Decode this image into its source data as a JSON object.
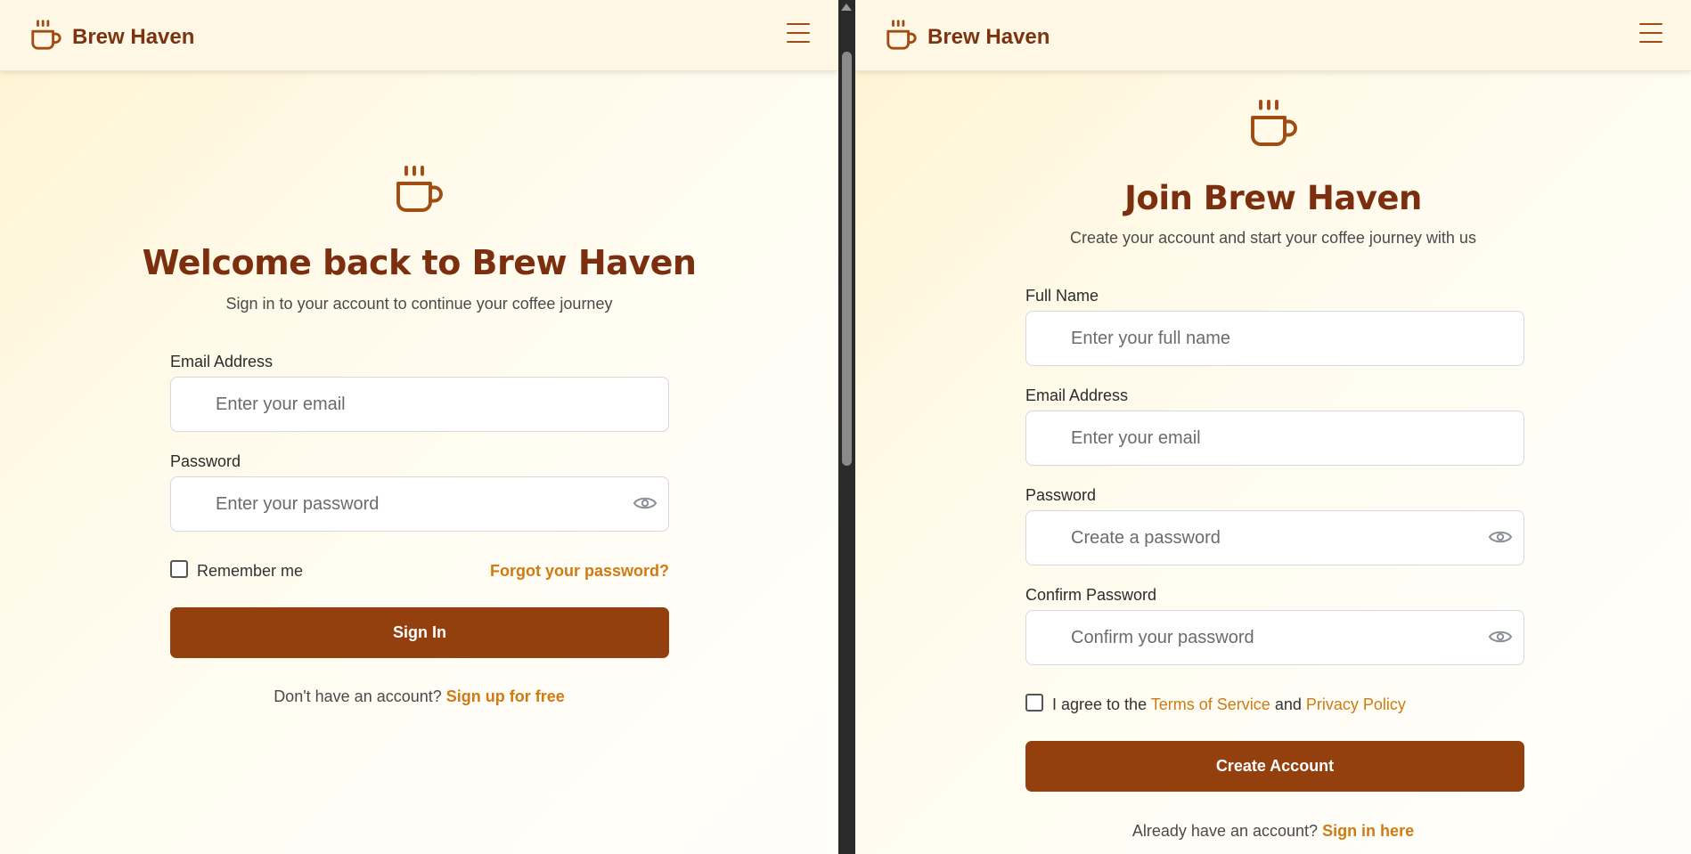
{
  "brand": {
    "name": "Brew Haven"
  },
  "colors": {
    "primary": "#93400e",
    "title": "#7c2f0e",
    "accent": "#d07a12",
    "background": "#fff8e6"
  },
  "icons": {
    "logo": "coffee-cup-icon",
    "menu": "hamburger-menu-icon",
    "reveal": "eye-icon"
  },
  "login": {
    "title": "Welcome back to Brew Haven",
    "subtitle": "Sign in to your account to continue your coffee journey",
    "email_label": "Email Address",
    "email_placeholder": "Enter your email",
    "password_label": "Password",
    "password_placeholder": "Enter your password",
    "remember_label": "Remember me",
    "forgot_link": "Forgot your password?",
    "submit": "Sign In",
    "footer_text": "Don't have an account?",
    "footer_link": "Sign up for free"
  },
  "signup": {
    "title": "Join Brew Haven",
    "subtitle": "Create your account and start your coffee journey with us",
    "name_label": "Full Name",
    "name_placeholder": "Enter your full name",
    "email_label": "Email Address",
    "email_placeholder": "Enter your email",
    "password_label": "Password",
    "password_placeholder": "Create a password",
    "confirm_label": "Confirm Password",
    "confirm_placeholder": "Confirm your password",
    "agree_prefix": "I agree to the",
    "terms_link": "Terms of Service",
    "agree_and": "and",
    "privacy_link": "Privacy Policy",
    "submit": "Create Account",
    "footer_text": "Already have an account?",
    "footer_link": "Sign in here"
  }
}
